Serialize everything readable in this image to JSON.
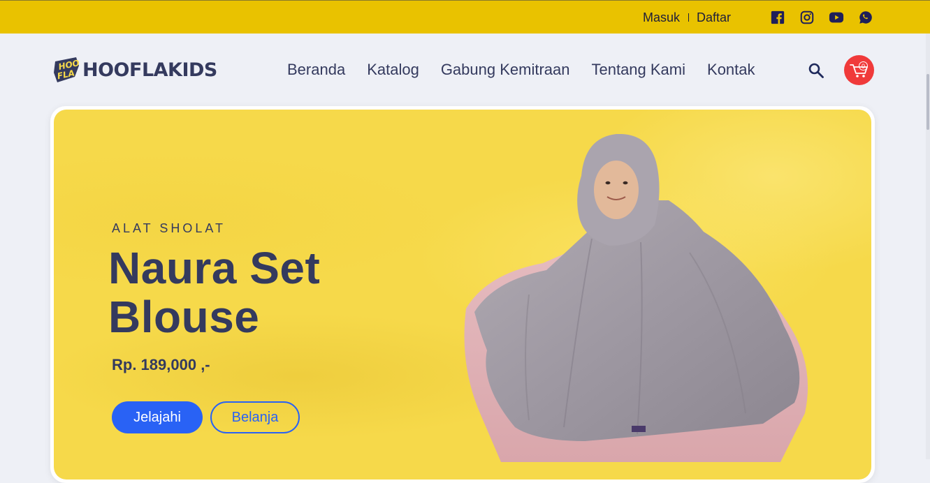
{
  "topbar": {
    "login_label": "Masuk",
    "register_label": "Daftar",
    "socials": [
      "facebook-icon",
      "instagram-icon",
      "youtube-icon",
      "whatsapp-icon"
    ],
    "background": "#e9c200"
  },
  "header": {
    "brand": "HOOFLAKIDS",
    "logo_badge": "HOO FLA",
    "nav": [
      "Beranda",
      "Katalog",
      "Gabung Kemitraan",
      "Tentang Kami",
      "Kontak"
    ],
    "cart_count": "0"
  },
  "hero": {
    "category": "ALAT SHOLAT",
    "title": "Naura Set Blouse",
    "price": "Rp. 189,000 ,-",
    "primary_button": "Jelajahi",
    "secondary_button": "Belanja",
    "background": "#f6d94a",
    "accent": "#2962f5"
  }
}
